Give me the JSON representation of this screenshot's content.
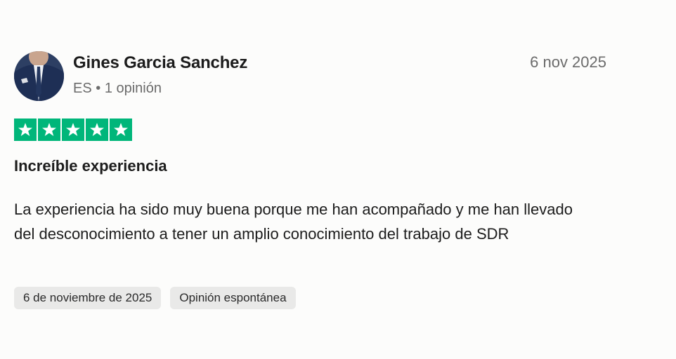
{
  "review": {
    "author_name": "Gines Garcia Sanchez",
    "author_country": "ES",
    "author_review_count": "1 opinión",
    "date": "6 nov 2025",
    "rating": 5,
    "rating_max": 5,
    "star_color": "#00b67a",
    "title": "Increíble experiencia",
    "body": "La experiencia ha sido muy buena porque me han acompañado y me han llevado del desconocimiento a tener un amplio conocimiento del trabajo de SDR",
    "tags": [
      {
        "label": "6 de noviembre de 2025"
      },
      {
        "label": "Opinión espontánea"
      }
    ]
  }
}
